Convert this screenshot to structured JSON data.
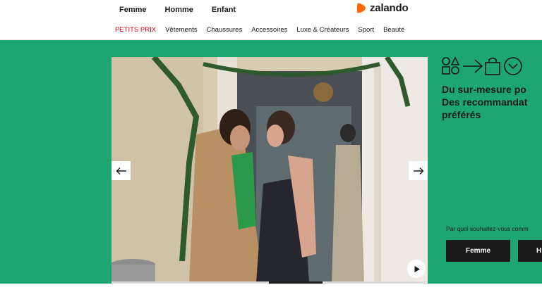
{
  "header": {
    "gender_nav": [
      "Femme",
      "Homme",
      "Enfant"
    ],
    "logo_text": "zalando",
    "category_nav": [
      "PETITS PRIX",
      "Vêtements",
      "Chaussures",
      "Accessoires",
      "Luxe & Créateurs",
      "Sport",
      "Beauté"
    ]
  },
  "banner": {
    "background_color": "#1ea672",
    "headline_lines": [
      "Du sur-mesure po",
      "Des recommandat",
      "préférés"
    ],
    "prompt": "Par quoi souhaitez-vous comm",
    "choices": [
      "Femme",
      "H"
    ],
    "icons": [
      "shapes-icon",
      "arrow-right-icon",
      "shopping-bag-icon",
      "chevron-circle-icon"
    ]
  },
  "hero": {
    "image": "photo-couple-kissing-doorway-holiday",
    "prev_icon": "arrow-left-icon",
    "next_icon": "arrow-right-icon",
    "play_icon": "play-icon"
  },
  "colors": {
    "accent_green": "#1ea672",
    "sale_red": "#e0001b",
    "logo_orange": "#ff6900",
    "dark": "#1a1a1a"
  }
}
